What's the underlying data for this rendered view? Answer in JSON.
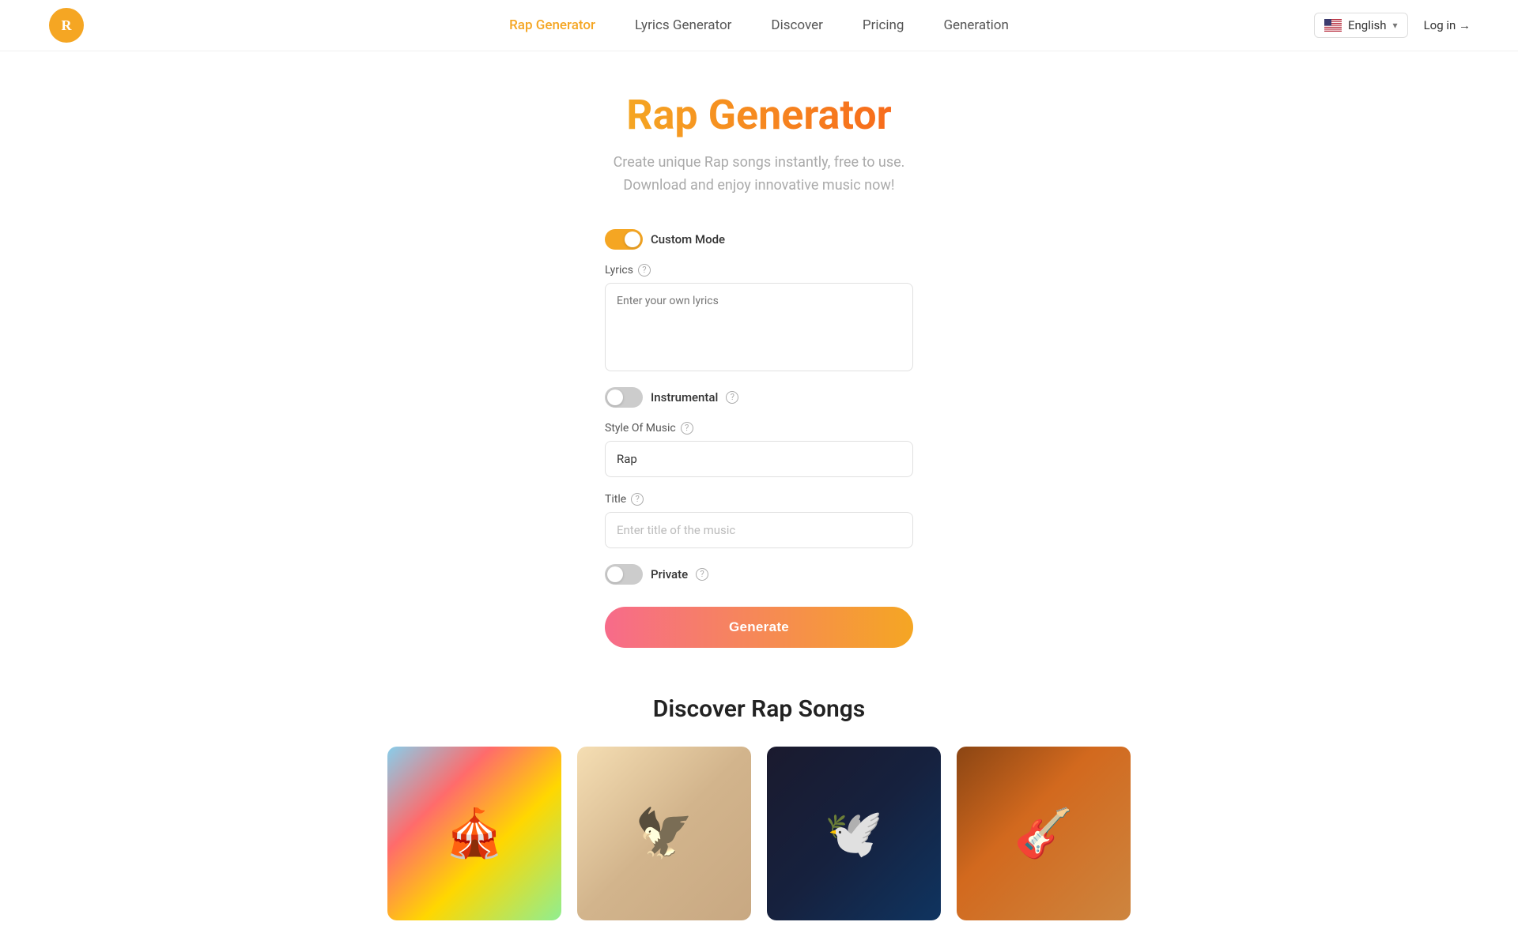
{
  "header": {
    "logo_alt": "Rap Generator Logo",
    "nav": {
      "items": [
        {
          "label": "Rap Generator",
          "active": true
        },
        {
          "label": "Lyrics Generator",
          "active": false
        },
        {
          "label": "Discover",
          "active": false
        },
        {
          "label": "Pricing",
          "active": false
        },
        {
          "label": "Generation",
          "active": false
        }
      ]
    },
    "language": {
      "label": "English",
      "flag_country": "US"
    },
    "login_label": "Log in →"
  },
  "hero": {
    "title": "Rap Generator",
    "subtitle_line1": "Create unique Rap songs instantly, free to use.",
    "subtitle_line2": "Download and enjoy innovative music now!"
  },
  "form": {
    "custom_mode_label": "Custom Mode",
    "custom_mode_on": true,
    "lyrics_label": "Lyrics",
    "lyrics_placeholder": "Enter your own lyrics",
    "instrumental_label": "Instrumental",
    "instrumental_on": false,
    "style_label": "Style Of Music",
    "style_value": "Rap",
    "title_label": "Title",
    "title_placeholder": "Enter title of the music",
    "private_label": "Private",
    "private_on": false,
    "generate_label": "Generate"
  },
  "discover": {
    "section_title": "Discover Rap Songs",
    "cards": [
      {
        "id": 1,
        "bg_class": "card-bg-1",
        "art_class": "card-1-art"
      },
      {
        "id": 2,
        "bg_class": "card-bg-2",
        "art_class": "card-2-art"
      },
      {
        "id": 3,
        "bg_class": "card-bg-3",
        "art_class": "card-3-art"
      },
      {
        "id": 4,
        "bg_class": "card-bg-4",
        "art_class": "card-4-art"
      }
    ]
  },
  "icons": {
    "help": "?",
    "chevron_down": "▾"
  }
}
